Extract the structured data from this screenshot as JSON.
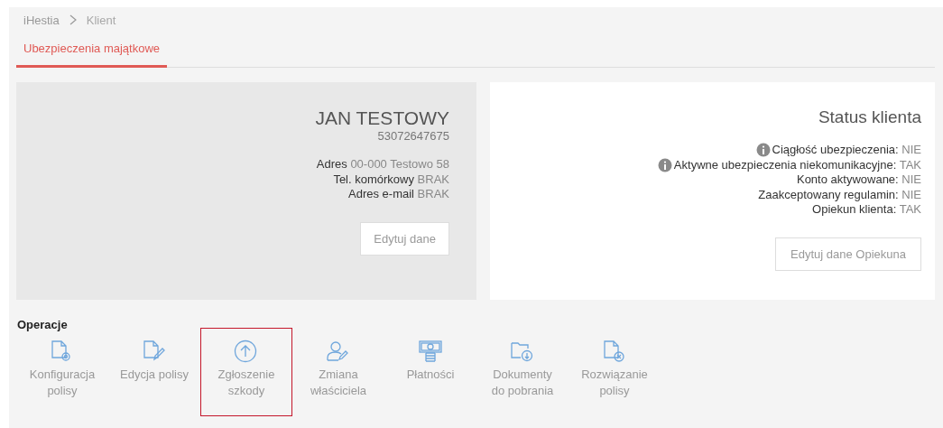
{
  "breadcrumb": [
    {
      "label": "iHestia",
      "current": false
    },
    {
      "label": "Klient",
      "current": true
    }
  ],
  "tabs": [
    {
      "label": "Ubezpieczenia majątkowe",
      "selected": true
    }
  ],
  "client_card": {
    "name": "JAN TESTOWY",
    "id_number": "53072647675",
    "fields": [
      {
        "label": "Adres",
        "value": "00-000 Testowo 58"
      },
      {
        "label": "Tel. komórkowy",
        "value": "BRAK"
      },
      {
        "label": "Adres e-mail",
        "value": "BRAK"
      }
    ],
    "button": "Edytuj dane"
  },
  "status_card": {
    "title": "Status klienta",
    "items": [
      {
        "label": "Ciągłość ubezpieczenia:",
        "value": "NIE",
        "info": true
      },
      {
        "label": "Aktywne ubezpieczenia niekomunikacyjne:",
        "value": "TAK",
        "info": true
      },
      {
        "label": "Konto aktywowane:",
        "value": "NIE",
        "info": false
      },
      {
        "label": "Zaakceptowany regulamin:",
        "value": "NIE",
        "info": false
      },
      {
        "label": "Opiekun klienta:",
        "value": "TAK",
        "info": false
      }
    ],
    "button": "Edytuj dane Opiekuna"
  },
  "operations": {
    "title": "Operacje",
    "items": [
      {
        "label": "Konfiguracja polisy",
        "kind": "config",
        "selected": false
      },
      {
        "label": "Edycja polisy",
        "kind": "edit",
        "selected": false
      },
      {
        "label": "Zgłoszenie szkody",
        "kind": "upload",
        "selected": true
      },
      {
        "label": "Zmiana właściciela",
        "kind": "owner",
        "selected": false
      },
      {
        "label": "Płatności",
        "kind": "payment",
        "selected": false
      },
      {
        "label": "Dokumenty do pobrania",
        "kind": "download",
        "selected": false
      },
      {
        "label": "Rozwiązanie polisy",
        "kind": "cancel",
        "selected": false
      }
    ]
  }
}
